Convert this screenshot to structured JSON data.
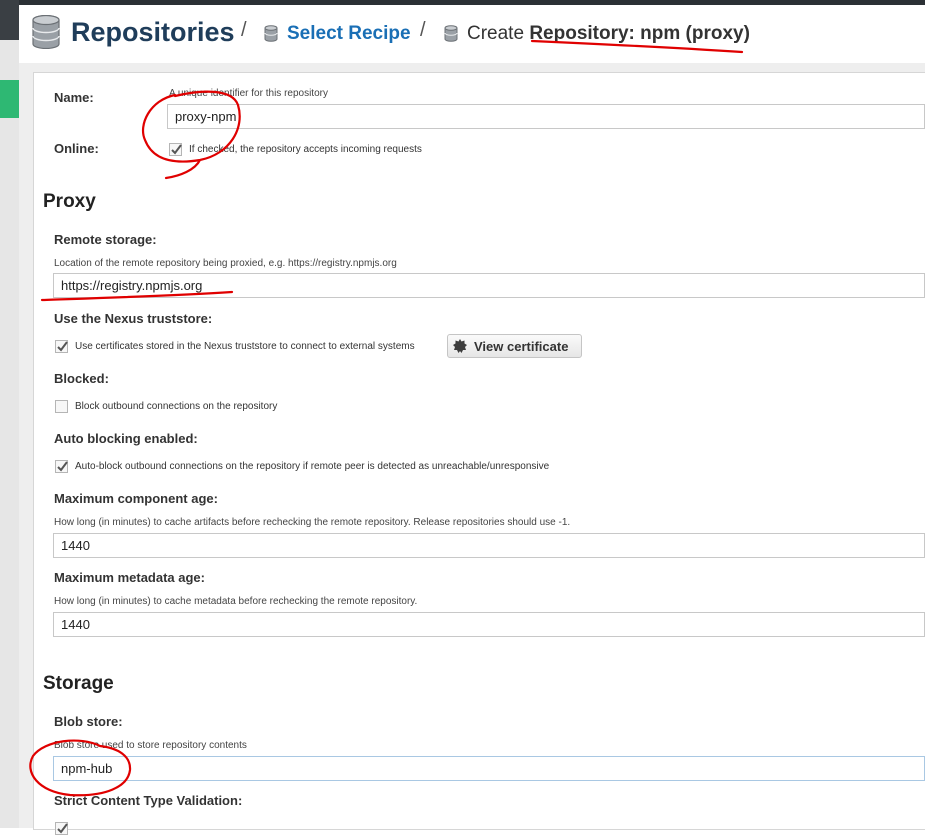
{
  "breadcrumb": {
    "root": "Repositories",
    "separator": "/",
    "step": "Select Recipe",
    "current_prefix": "Create",
    "current": "Repository: npm (proxy)"
  },
  "form": {
    "name": {
      "label": "Name:",
      "help": "A unique identifier for this repository",
      "value": "proxy-npm"
    },
    "online": {
      "label": "Online:",
      "checked": true,
      "text": "If checked, the repository accepts incoming requests"
    }
  },
  "proxy": {
    "title": "Proxy",
    "remote_storage": {
      "label": "Remote storage:",
      "help": "Location of the remote repository being proxied, e.g. https://registry.npmjs.org",
      "value": "https://registry.npmjs.org"
    },
    "truststore": {
      "label": "Use the Nexus truststore:",
      "checked": true,
      "text": "Use certificates stored in the Nexus truststore to connect to external systems",
      "button_label": "View certificate"
    },
    "blocked": {
      "label": "Blocked:",
      "checked": false,
      "text": "Block outbound connections on the repository"
    },
    "auto_blocking": {
      "label": "Auto blocking enabled:",
      "checked": true,
      "text": "Auto-block outbound connections on the repository if remote peer is detected as unreachable/unresponsive"
    },
    "max_component_age": {
      "label": "Maximum component age:",
      "help": "How long (in minutes) to cache artifacts before rechecking the remote repository. Release repositories should use -1.",
      "value": "1440"
    },
    "max_metadata_age": {
      "label": "Maximum metadata age:",
      "help": "How long (in minutes) to cache metadata before rechecking the remote repository.",
      "value": "1440"
    }
  },
  "storage": {
    "title": "Storage",
    "blob_store": {
      "label": "Blob store:",
      "help": "Blob store used to store repository contents",
      "value": "npm-hub"
    },
    "strict_validation": {
      "label": "Strict Content Type Validation:",
      "checked": true
    }
  },
  "colors": {
    "brand_dark": "#1f3d5a",
    "link": "#1a6fb5",
    "annotation_red": "#e00000",
    "sidebar_green": "#2eb873"
  }
}
